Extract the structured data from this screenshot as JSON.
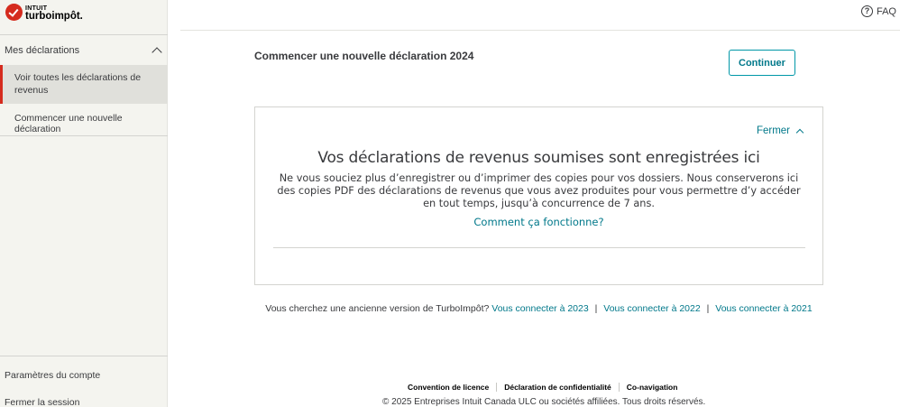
{
  "brand": {
    "intuit": "INTUIT",
    "product": "turboimpôt.",
    "logo_icon": "checkmark-circle-icon",
    "logo_color": "#d52b1e"
  },
  "sidebar": {
    "section_title": "Mes déclarations",
    "items": [
      {
        "label": "Voir toutes les déclarations de revenus",
        "active": true
      },
      {
        "label": "Commencer une nouvelle déclaration",
        "active": false
      }
    ],
    "bottom_links": [
      {
        "label": "Paramètres du compte"
      },
      {
        "label": "Fermer la session"
      }
    ]
  },
  "topbar": {
    "faq_label": "FAQ",
    "faq_icon": "help-circle-icon"
  },
  "main": {
    "new_return_title": "Commencer une nouvelle déclaration 2024",
    "continue_label": "Continuer",
    "card": {
      "close_label": "Fermer",
      "title": "Vos déclarations de revenus soumises sont enregistrées ici",
      "body": "Ne vous souciez plus d’enregistrer ou d’imprimer des copies pour vos dossiers. Nous conserverons ici des copies PDF des déclarations de revenus que vous avez produites pour vous permettre d’y accéder en tout temps, jusqu’à concurrence de 7 ans.",
      "how_link": "Comment ça fonctionne?"
    },
    "older_versions": {
      "prompt": "Vous cherchez une ancienne version de TurboImpôt?",
      "links": [
        "Vous connecter à 2023",
        "Vous connecter à 2022",
        "Vous connecter à 2021"
      ],
      "separator": "|"
    }
  },
  "footer": {
    "links": [
      "Convention de licence",
      "Déclaration de confidentialité",
      "Co-navigation"
    ],
    "copyright": "© 2025 Entreprises Intuit Canada ULC ou sociétés affiliées. Tous droits réservés."
  },
  "colors": {
    "accent": "#00788a",
    "sidebar_bg": "#f4f4ef",
    "active_marker": "#d52b1e"
  }
}
